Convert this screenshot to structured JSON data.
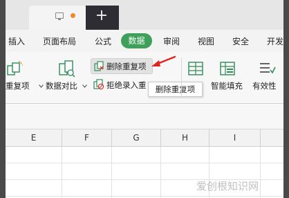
{
  "titlebar": {
    "plus_glyph": "+"
  },
  "menu": {
    "items": [
      {
        "label": "插入"
      },
      {
        "label": "页面布局"
      },
      {
        "label": "公式"
      },
      {
        "label": "数据",
        "active": true
      },
      {
        "label": "审阅"
      },
      {
        "label": "视图"
      },
      {
        "label": "安全"
      },
      {
        "label": "开发"
      }
    ],
    "active_color": "#3ea05a"
  },
  "ribbon": {
    "remove_duplicates": "重复项",
    "data_compare": "数据对比",
    "delete_duplicates": "删除重复项",
    "reject_duplicates": "拒绝录入重",
    "smart_fill": "智能填充",
    "validity": "有效性",
    "tooltip": "删除重复项"
  },
  "columns": [
    "E",
    "F",
    "G",
    "H",
    "I"
  ],
  "colors": {
    "arrow": "#e0241f",
    "icon_green": "#2e8b57"
  },
  "watermark": "爱创根知识网"
}
